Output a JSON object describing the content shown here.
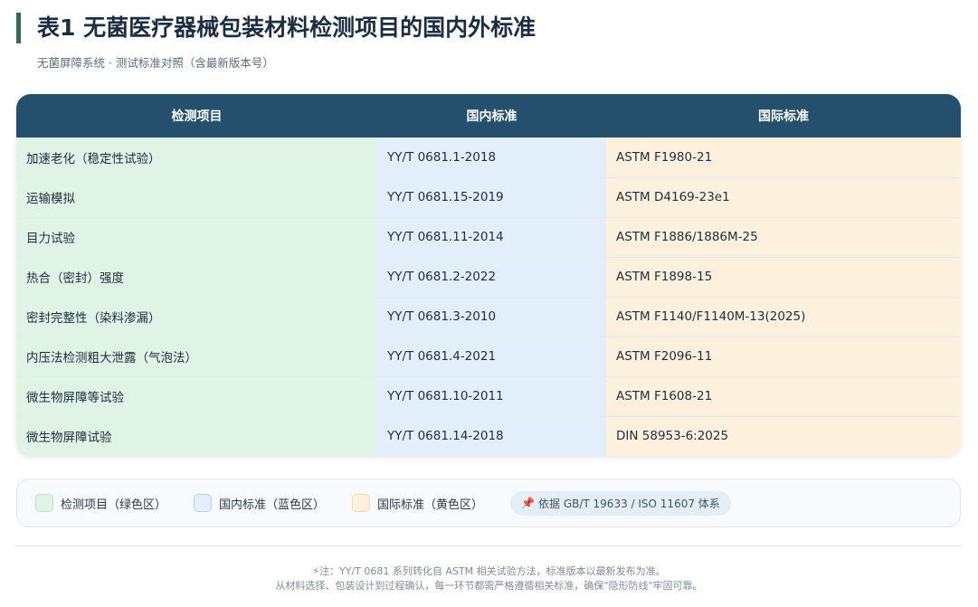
{
  "header": {
    "title": "表1 无菌医疗器械包装材料检测项目的国内外标准",
    "subtitle": "无菌屏障系统 · 测试标准对照（含最新版本号）"
  },
  "table": {
    "columns": [
      "检测项目",
      "国内标准",
      "国际标准"
    ],
    "rows": [
      [
        "加速老化（稳定性试验）",
        "YY/T 0681.1-2018",
        "ASTM F1980-21"
      ],
      [
        "运输模拟",
        "YY/T 0681.15-2019",
        "ASTM D4169-23e1"
      ],
      [
        "目力试验",
        "YY/T 0681.11-2014",
        "ASTM F1886/1886M-25"
      ],
      [
        "热合（密封）强度",
        "YY/T 0681.2-2022",
        "ASTM F1898-15"
      ],
      [
        "密封完整性（染料渗漏）",
        "YY/T 0681.3-2010",
        "ASTM F1140/F1140M-13(2025)"
      ],
      [
        "内压法检测粗大泄露（气泡法）",
        "YY/T 0681.4-2021",
        "ASTM F2096-11"
      ],
      [
        "微生物屏障等试验",
        "YY/T 0681.10-2011",
        "ASTM F1608-21"
      ],
      [
        "微生物屏障试验",
        "YY/T 0681.14-2018",
        "DIN 58953-6:2025"
      ]
    ]
  },
  "legend": {
    "items": [
      {
        "label": "检测项目（绿色区）",
        "color": "#e0f4e6"
      },
      {
        "label": "国内标准（蓝色区）",
        "color": "#e3eefb"
      },
      {
        "label": "国际标准（黄色区）",
        "color": "#fdf1dd"
      }
    ],
    "basis_icon": "pin-icon",
    "basis": "依据 GB/T 19633 / ISO 11607 体系"
  },
  "footer": {
    "note_line1": "⚡注：YY/T 0681 系列转化自 ASTM 相关试验方法，标准版本以最新发布为准。",
    "note_line2": "从材料选择、包装设计到过程确认，每一环节都需严格遵循相关标准，确保\"隐形防线\"牢固可靠。"
  },
  "colors": {
    "header_bg": "#24506e",
    "accent_bar": "#2f6e4f",
    "green_zone": "#e0f4e6",
    "blue_zone": "#e3eefb",
    "yellow_zone": "#fdf1dd"
  }
}
